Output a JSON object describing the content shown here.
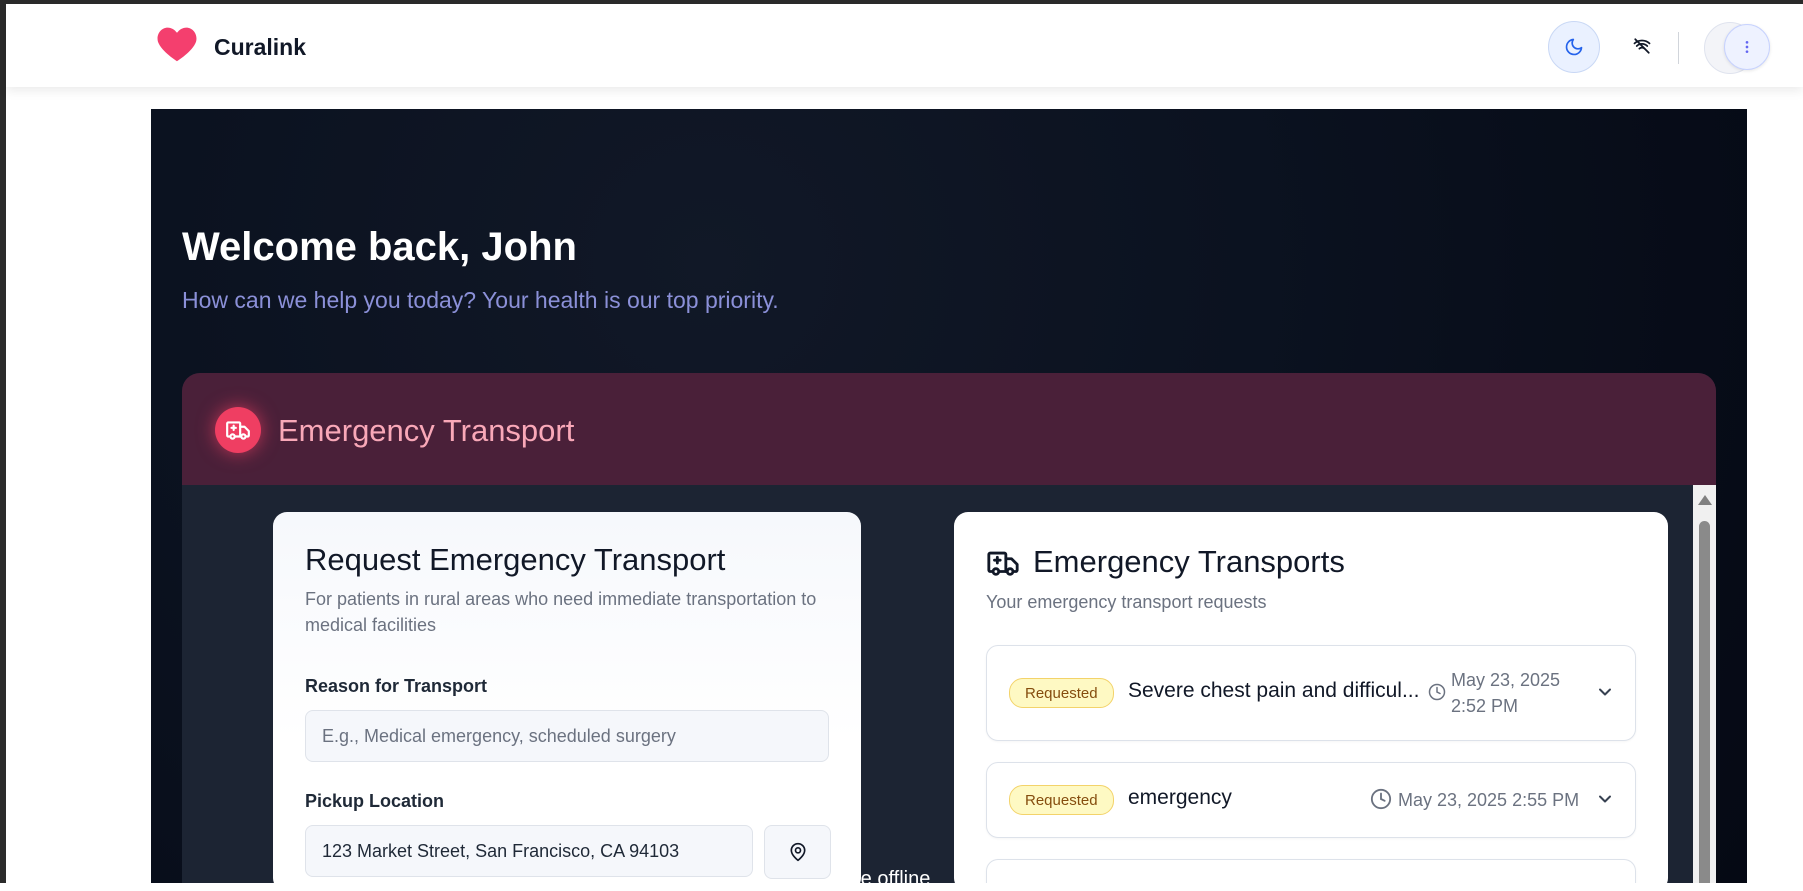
{
  "header": {
    "brand": "Curalink",
    "colors": {
      "heart": "#f43f6e",
      "accent": "#3b6fe0"
    },
    "icons": [
      "heart-icon",
      "moon-icon",
      "wifi-off-icon",
      "more-vertical-icon"
    ]
  },
  "welcome": {
    "title": "Welcome back, John",
    "subtitle": "How can we help you today? Your health is our top priority."
  },
  "emergency": {
    "section_title": "Emergency Transport",
    "request": {
      "title": "Request Emergency Transport",
      "description": "For patients in rural areas who need immediate transportation to medical facilities",
      "reason_label": "Reason for Transport",
      "reason_placeholder": "E.g., Medical emergency, scheduled surgery",
      "pickup_label": "Pickup Location",
      "pickup_value": "123 Market Street, San Francisco, CA 94103"
    },
    "offline_text": "re offline",
    "transports": {
      "title": "Emergency Transports",
      "subtitle": "Your emergency transport requests",
      "items": [
        {
          "status": "Requested",
          "title": "Severe chest pain and difficul...",
          "date": "May 23, 2025",
          "time": "2:52 PM"
        },
        {
          "status": "Requested",
          "title": "emergency",
          "date": "May 23, 2025 2:55 PM"
        }
      ]
    }
  }
}
